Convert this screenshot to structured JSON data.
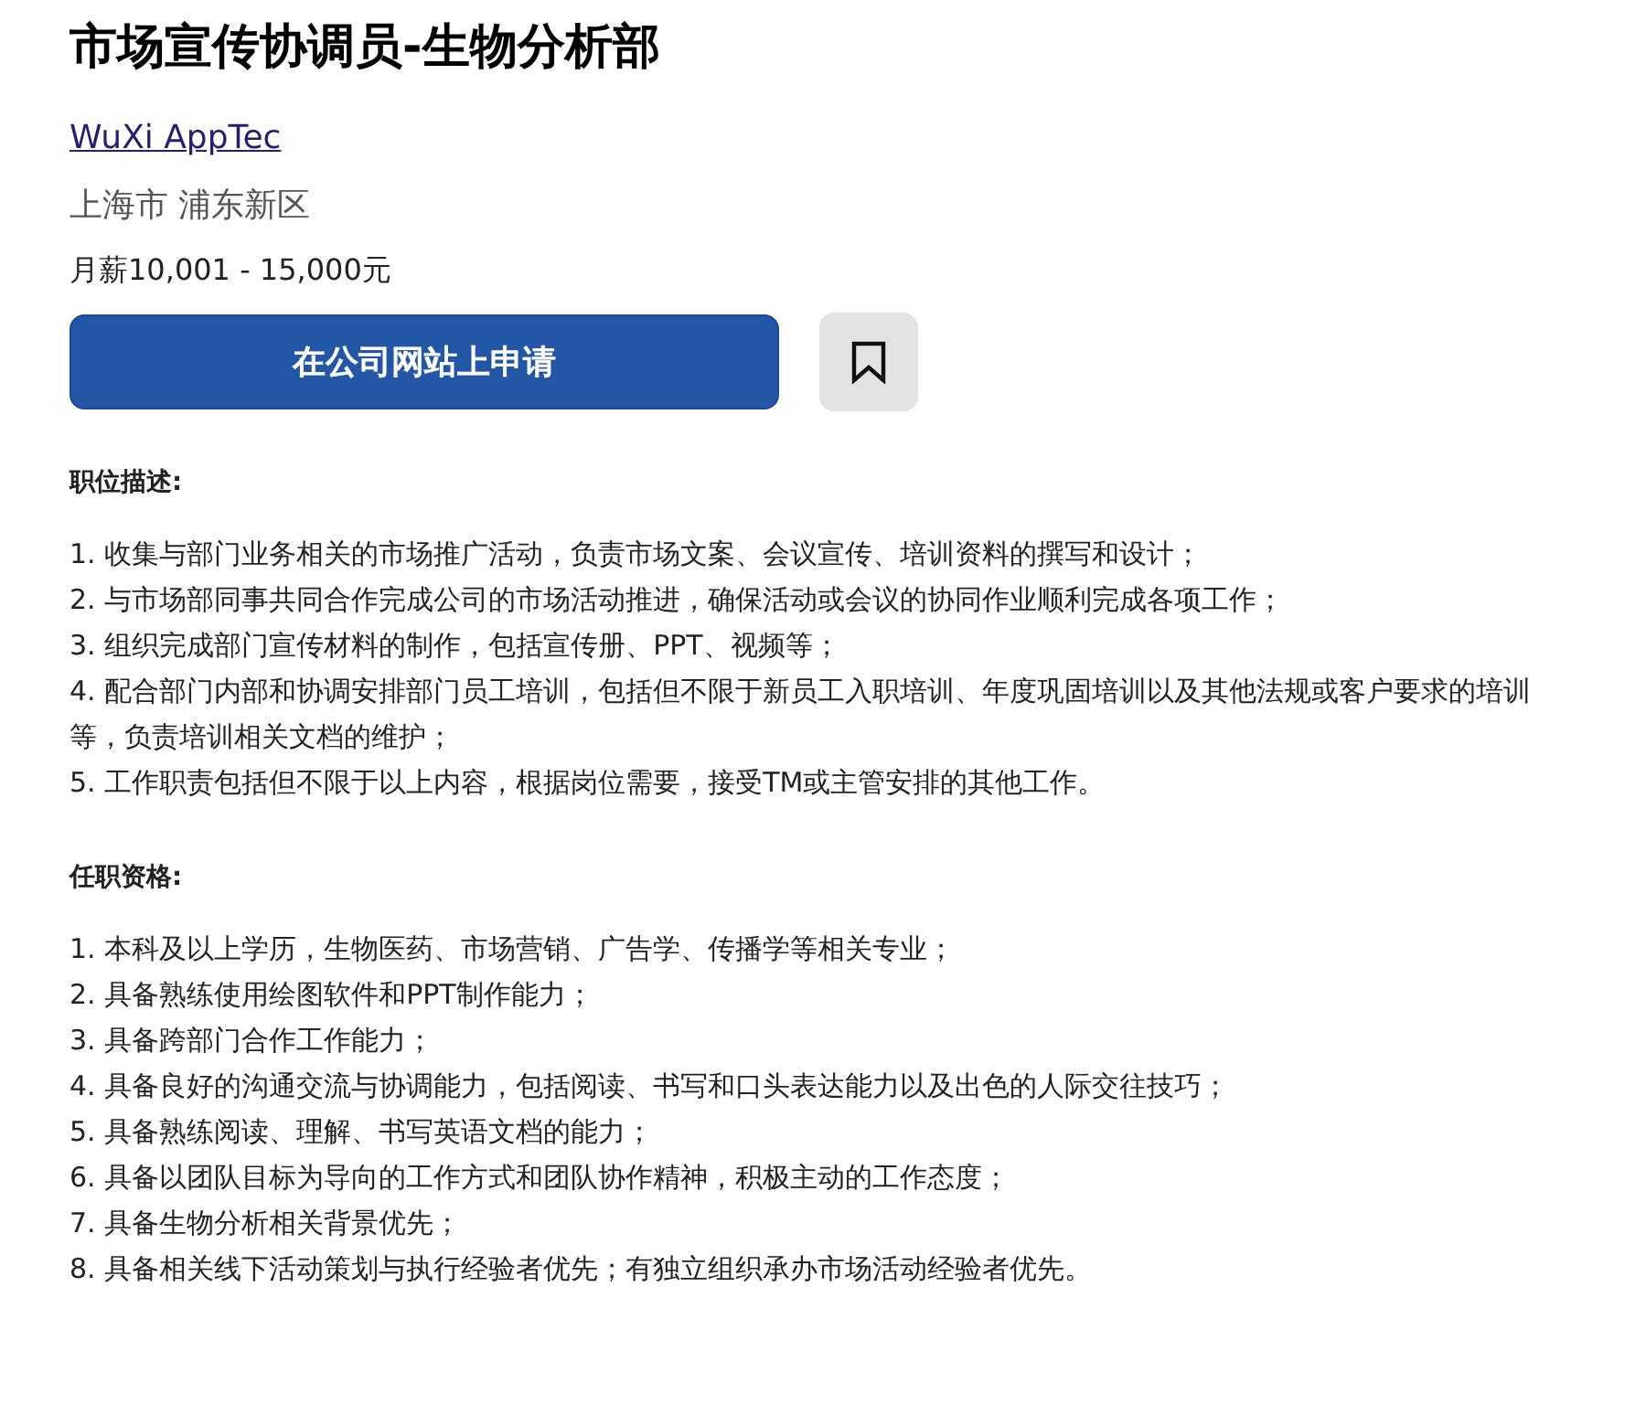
{
  "job": {
    "title": "市场宣传协调员-生物分析部",
    "company": "WuXi AppTec",
    "location": "上海市 浦东新区",
    "salary": "月薪10,001 - 15,000元"
  },
  "actions": {
    "apply_button": "在公司网站上申请",
    "saved": false
  },
  "sections": [
    {
      "heading": "职位描述:",
      "items": [
        "1. 收集与部门业务相关的市场推广活动，负责市场文案、会议宣传、培训资料的撰写和设计；",
        "2. 与市场部同事共同合作完成公司的市场活动推进，确保活动或会议的协同作业顺利完成各项工作；",
        "3. 组织完成部门宣传材料的制作，包括宣传册、PPT、视频等；",
        "4. 配合部门内部和协调安排部门员工培训，包括但不限于新员工入职培训、年度巩固培训以及其他法规或客户要求的培训等，负责培训相关文档的维护；",
        "5. 工作职责包括但不限于以上内容，根据岗位需要，接受TM或主管安排的其他工作。"
      ]
    },
    {
      "heading": "任职资格:",
      "items": [
        "1. 本科及以上学历，生物医药、市场营销、广告学、传播学等相关专业；",
        "2. 具备熟练使用绘图软件和PPT制作能力；",
        "3. 具备跨部门合作工作能力；",
        "4. 具备良好的沟通交流与协调能力，包括阅读、书写和口头表达能力以及出色的人际交往技巧；",
        "5. 具备熟练阅读、理解、书写英语文档的能力；",
        "6. 具备以团队目标为导向的工作方式和团队协作精神，积极主动的工作态度；",
        "7. 具备生物分析相关背景优先；",
        "8. 具备相关线下活动策划与执行经验者优先；有独立组织承办市场活动经验者优先。"
      ]
    }
  ]
}
